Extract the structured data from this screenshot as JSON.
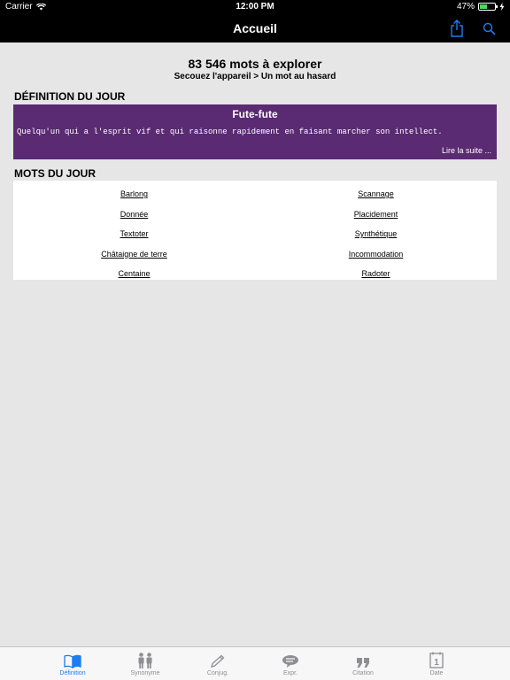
{
  "status": {
    "carrier": "Carrier",
    "time": "12:00 PM",
    "battery": "47%",
    "battery_level": 0.47
  },
  "nav": {
    "title": "Accueil",
    "share_icon": "share-icon",
    "search_icon": "search-icon"
  },
  "header": {
    "count": "83 546 mots à explorer",
    "hint": "Secouez l'appareil > Un mot au hasard"
  },
  "definition": {
    "section_title": "DÉFINITION DU JOUR",
    "word": "Fute-fute",
    "text": "Quelqu'un qui a l'esprit vif et qui raisonne rapidement en faisant marcher son intellect.",
    "more": "Lire la suite ..."
  },
  "words": {
    "section_title": "MOTS DU JOUR",
    "left": [
      "Barlong",
      "Donnée",
      "Textoter",
      "Châtaigne de terre",
      "Centaine"
    ],
    "right": [
      "Scannage",
      "Placidement",
      "Synthétique",
      "Incommodation",
      "Radoter"
    ]
  },
  "tabs": [
    {
      "label": "Définition",
      "icon": "book-icon",
      "active": true
    },
    {
      "label": "Synonyme",
      "icon": "people-icon",
      "active": false
    },
    {
      "label": "Conjug.",
      "icon": "pencil-icon",
      "active": false
    },
    {
      "label": "Expr.",
      "icon": "speech-bubble-icon",
      "active": false
    },
    {
      "label": "Citation",
      "icon": "quote-icon",
      "active": false
    },
    {
      "label": "Date",
      "icon": "calendar-icon",
      "active": false
    }
  ],
  "colors": {
    "accent": "#1e7cf2",
    "definition_bg": "#5a2a73",
    "background": "#e6e6e6"
  }
}
